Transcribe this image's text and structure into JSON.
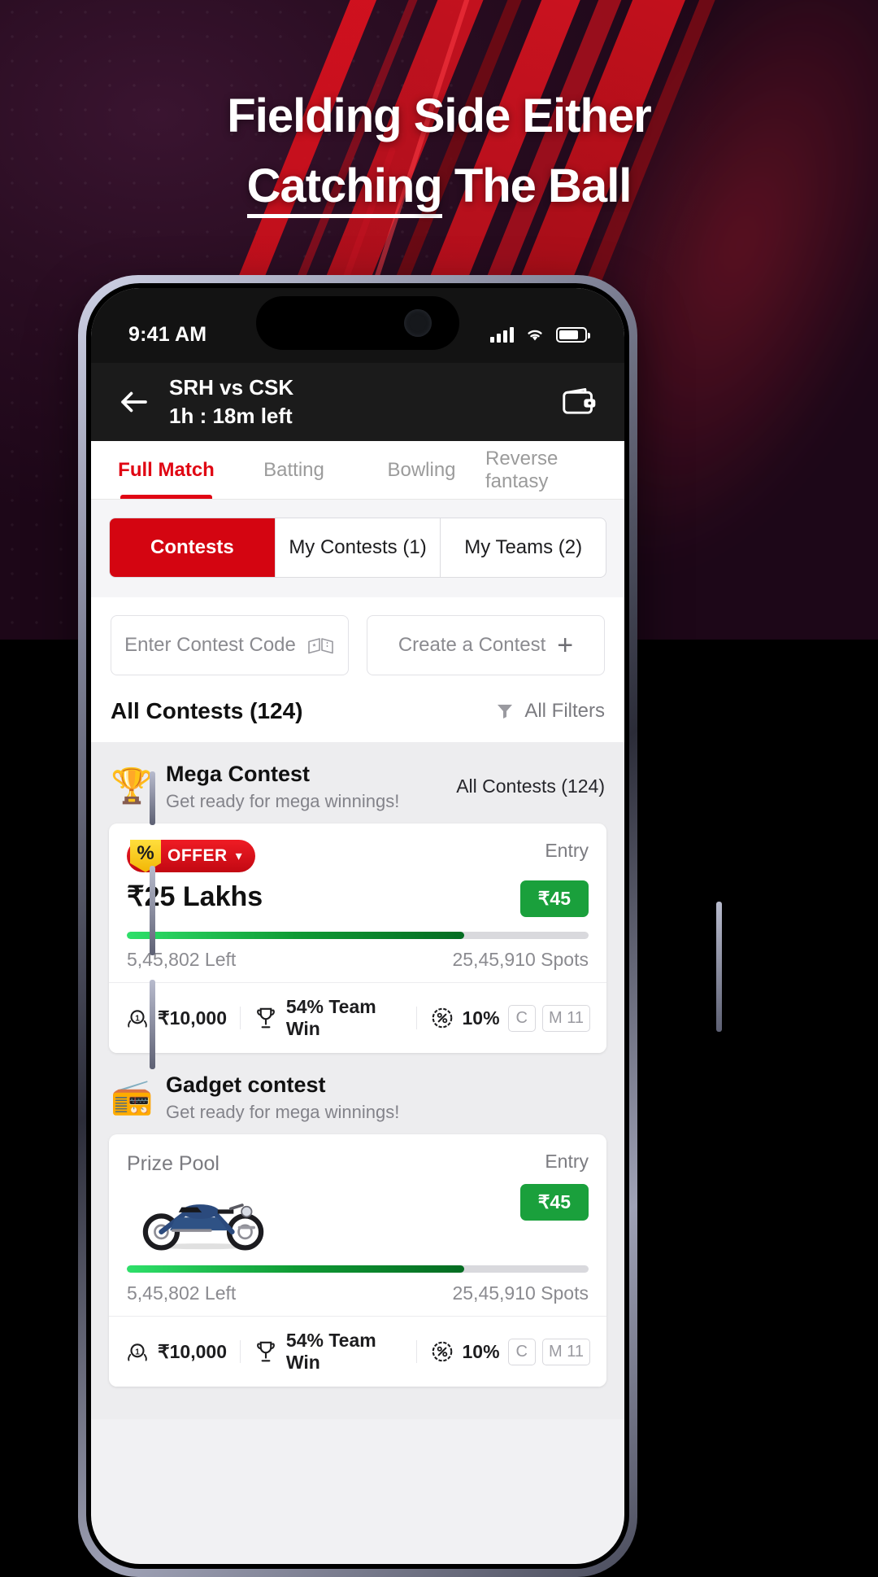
{
  "promo": {
    "headline_line1": "Fielding Side Either",
    "headline_line2_underlined": "Catching",
    "headline_line2_rest": " The Ball"
  },
  "status_bar": {
    "time": "9:41 AM",
    "signal_icon": "cellular-signal-icon",
    "wifi_icon": "wifi-icon",
    "battery_icon": "battery-icon"
  },
  "app_header": {
    "back_icon": "back-arrow-icon",
    "match_title": "SRH vs CSK",
    "time_left": "1h : 18m left",
    "wallet_icon": "wallet-icon"
  },
  "tabs": [
    {
      "label": "Full Match",
      "active": true
    },
    {
      "label": "Batting",
      "active": false
    },
    {
      "label": "Bowling",
      "active": false
    },
    {
      "label": "Reverse fantasy",
      "active": false
    }
  ],
  "segmented": [
    {
      "label": "Contests",
      "active": true
    },
    {
      "label": "My Contests (1)",
      "active": false
    },
    {
      "label": "My Teams (2)",
      "active": false
    }
  ],
  "code_row": {
    "enter_code_label": "Enter Contest Code",
    "enter_code_icon": "ticket-icon",
    "create_contest_label": "Create a Contest",
    "create_contest_icon": "plus-icon"
  },
  "all_contests": {
    "title": "All Contests (124)",
    "filter_label": "All Filters",
    "filter_icon": "funnel-icon"
  },
  "sections": [
    {
      "icon": "trophy-icon",
      "title": "Mega Contest",
      "subtitle": "Get ready for mega winnings!",
      "link": "All Contests (124)",
      "card": {
        "offer_badge_symbol": "%",
        "offer_label": "OFFER",
        "offer_chevron": "chevron-down-icon",
        "entry_label": "Entry",
        "prize_pool_label": "",
        "prize": "₹25 Lakhs",
        "entry_fee": "₹45",
        "progress_percent": 73,
        "spots_left": "5,45,802 Left",
        "total_spots": "25,45,910 Spots",
        "stats": [
          {
            "icon": "medal-icon",
            "value": "₹10,000"
          },
          {
            "icon": "trophy-cup-icon",
            "value": "54% Team Win"
          },
          {
            "icon": "percent-badge-icon",
            "value": "10%"
          }
        ],
        "tags": [
          "C",
          "M",
          "11"
        ]
      }
    },
    {
      "icon": "gadget-icon",
      "title": "Gadget contest",
      "subtitle": "Get ready for mega winnings!",
      "link": "",
      "card": {
        "offer_badge_symbol": "",
        "offer_label": "",
        "offer_chevron": "",
        "entry_label": "Entry",
        "prize_pool_label": "Prize Pool",
        "prize": "",
        "entry_fee": "₹45",
        "progress_percent": 73,
        "spots_left": "5,45,802 Left",
        "total_spots": "25,45,910 Spots",
        "stats": [
          {
            "icon": "medal-icon",
            "value": "₹10,000"
          },
          {
            "icon": "trophy-cup-icon",
            "value": "54% Team Win"
          },
          {
            "icon": "percent-badge-icon",
            "value": "10%"
          }
        ],
        "tags": [
          "C",
          "M",
          "11"
        ],
        "prize_image": "motorcycle-image"
      }
    }
  ],
  "colors": {
    "brand_red": "#d40511",
    "tab_red": "#e00613",
    "entry_green": "#1aa03c",
    "dark_header": "#1b1b1b"
  }
}
